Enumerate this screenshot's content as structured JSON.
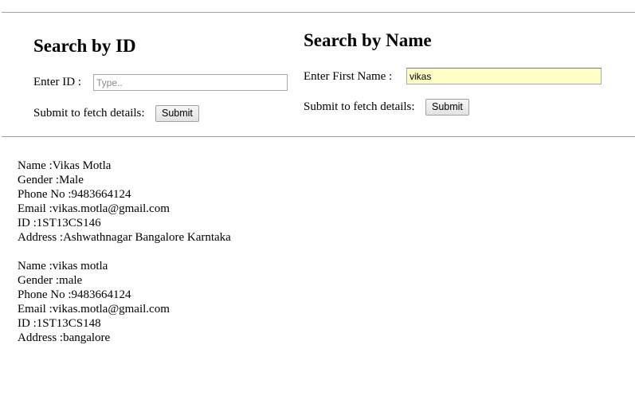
{
  "search_by_id": {
    "heading": "Search by ID",
    "id_label": "Enter ID :",
    "id_placeholder": "Type..",
    "id_value": "",
    "submit_prompt": "Submit to fetch details:",
    "submit_label": "Submit"
  },
  "search_by_name": {
    "heading": "Search by Name",
    "name_label": "Enter First Name :",
    "name_value": "vikas",
    "submit_prompt": "Submit to fetch details:",
    "submit_label": "Submit"
  },
  "results": [
    {
      "name": "Name :Vikas Motla",
      "gender": "Gender :Male",
      "phone": "Phone No :9483664124",
      "email": "Email :vikas.motla@gmail.com",
      "id": "ID :1ST13CS146",
      "address": "Address :Ashwathnagar Bangalore Karntaka"
    },
    {
      "name": "Name :vikas motla",
      "gender": "Gender :male",
      "phone": "Phone No :9483664124",
      "email": "Email :vikas.motla@gmail.com",
      "id": "ID :1ST13CS148",
      "address": "Address :bangalore"
    }
  ],
  "colors": {
    "autofill_background": "#ffffc8",
    "divider": "#a0a0a0"
  }
}
